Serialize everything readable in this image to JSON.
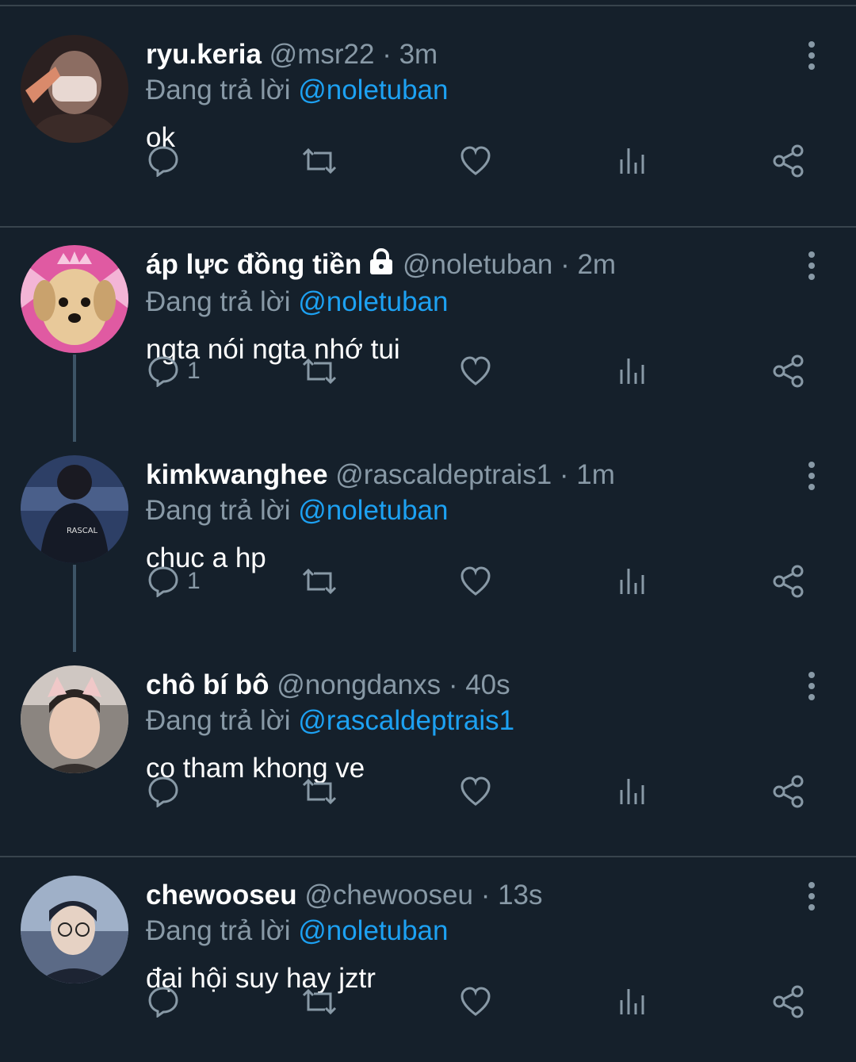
{
  "replying_label": "Đang trả lời",
  "tweets": [
    {
      "name": "ryu.keria",
      "handle": "@msr22",
      "dot": "·",
      "time": "3m",
      "replying_to": "@noletuban",
      "text": "ok",
      "reply_count": "",
      "locked": false,
      "avatar_colors": [
        "#6b5148",
        "#2b2020"
      ]
    },
    {
      "name": "áp lực đồng tiền",
      "handle": "@noletuban",
      "dot": "·",
      "time": "2m",
      "replying_to": "@noletuban",
      "text": "ngta nói ngta nhớ tui",
      "reply_count": "1",
      "locked": true,
      "avatar_colors": [
        "#e8c99a",
        "#e05aa2"
      ]
    },
    {
      "name": "kimkwanghee",
      "handle": "@rascaldeptrais1",
      "dot": "·",
      "time": "1m",
      "replying_to": "@noletuban",
      "text": "chuc a hp",
      "reply_count": "1",
      "locked": false,
      "avatar_colors": [
        "#2d3f66",
        "#0f1626"
      ]
    },
    {
      "name": "chô bí bô",
      "handle": "@nongdanxs",
      "dot": "·",
      "time": "40s",
      "replying_to": "@rascaldeptrais1",
      "text": "co tham khong ve",
      "reply_count": "",
      "locked": false,
      "avatar_colors": [
        "#d9b9a8",
        "#35302e"
      ]
    },
    {
      "name": "chewooseu",
      "handle": "@chewooseu",
      "dot": "·",
      "time": "13s",
      "replying_to": "@noletuban",
      "text": "đại hội suy hay jztr",
      "reply_count": "",
      "locked": false,
      "avatar_colors": [
        "#9fb0c8",
        "#1d2433"
      ]
    }
  ],
  "icons": {
    "reply": "reply-icon",
    "retweet": "retweet-icon",
    "like": "heart-icon",
    "analytics": "analytics-icon",
    "share": "share-icon",
    "more": "more-vertical-icon",
    "lock": "lock-icon"
  },
  "colors": {
    "background": "#15202b",
    "secondary_text": "#8899a6",
    "link": "#1da1f2",
    "divider": "#38444d"
  }
}
